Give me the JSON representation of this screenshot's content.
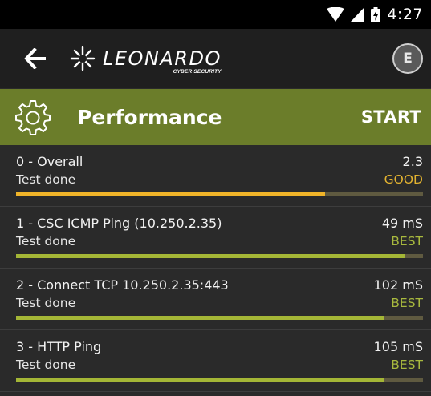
{
  "status_bar": {
    "time": "4:27",
    "icons": [
      "wifi-icon",
      "signal-icon",
      "battery-icon"
    ]
  },
  "app_bar": {
    "back_icon": "arrow-left-icon",
    "brand_name": "LEONARDO",
    "brand_subtitle": "CYBER SECURITY",
    "menu_glyph": "E"
  },
  "section": {
    "icon": "gear-icon",
    "title": "Performance",
    "start_label": "START",
    "color": "#6b7d2a"
  },
  "tests": [
    {
      "title": "0 - Overall",
      "value": "2.3",
      "status": "Test done",
      "rating": "GOOD",
      "rating_color": "#e3b330",
      "bar_color": "#f0b429",
      "progress": 0.76
    },
    {
      "title": "1 - CSC ICMP Ping (10.250.2.35)",
      "value": "49 mS",
      "status": "Test done",
      "rating": "BEST",
      "rating_color": "#a8b93e",
      "bar_color": "#a4b636",
      "progress": 0.955
    },
    {
      "title": "2 - Connect TCP 10.250.2.35:443",
      "value": "102 mS",
      "status": "Test done",
      "rating": "BEST",
      "rating_color": "#a8b93e",
      "bar_color": "#a4b636",
      "progress": 0.905
    },
    {
      "title": "3 - HTTP Ping",
      "value": "105 mS",
      "status": "Test done",
      "rating": "BEST",
      "rating_color": "#a8b93e",
      "bar_color": "#a4b636",
      "progress": 0.905
    }
  ]
}
